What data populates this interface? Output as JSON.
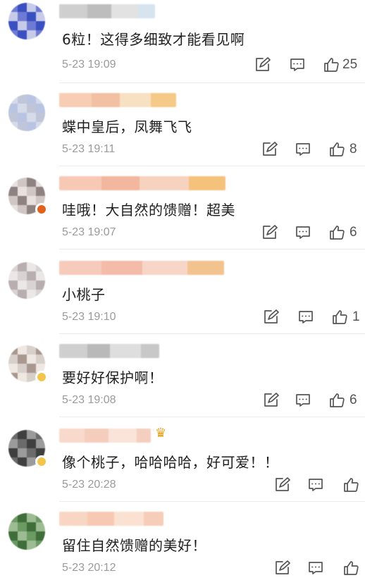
{
  "comments": [
    {
      "text": "6粒！这得多细致才能看见啊",
      "time": "5-23 19:09",
      "likes": "25",
      "avatar_colors": [
        "#6f7bd3",
        "#3a4fc0",
        "#c7cbe8"
      ],
      "name_colors": [
        "#cfcfcf",
        "#bdbdbd",
        "#e2e2e2",
        "#d6e4f0"
      ]
    },
    {
      "text": "蝶中皇后，凤舞飞飞",
      "time": "5-23 19:11",
      "likes": "8",
      "avatar_colors": [
        "#b9c3e2",
        "#d6dbe9",
        "#c0c6d8"
      ],
      "name_colors": [
        "#f7cdb4",
        "#f2c0a2",
        "#f8e0c3",
        "#f5c987"
      ]
    },
    {
      "text": "哇哦！大自然的馈赠！超美",
      "time": "5-23 19:07",
      "likes": "6",
      "avatar_colors": [
        "#d0c7c4",
        "#8e8381",
        "#e9e1dd"
      ],
      "name_colors": [
        "#f7c9b5",
        "#f2b79e",
        "#f7d2bf",
        "#f5c27c"
      ]
    },
    {
      "text": "小桃子",
      "time": "5-23 19:10",
      "likes": "1",
      "avatar_colors": [
        "#d9d3d3",
        "#b8aeb0",
        "#ebe7e7"
      ],
      "name_colors": [
        "#f6cbbb",
        "#f3bba8",
        "#f7d6c8",
        "#f2c38f"
      ]
    },
    {
      "text": "要好好保护啊！",
      "time": "5-23 19:08",
      "likes": "6",
      "avatar_colors": [
        "#d7cfc9",
        "#a99890",
        "#efe7e1"
      ],
      "name_colors": [
        "#cfcfcf",
        "#b9b9b9",
        "#dedede",
        "#c8c8c8"
      ]
    },
    {
      "text": "像个桃子，哈哈哈哈，好可爱！！",
      "time": "5-23 20:28",
      "likes": "",
      "avatar_colors": [
        "#3f3f3f",
        "#9b9b9b",
        "#6b6b6b"
      ],
      "name_colors": [
        "#f9d9cc",
        "#f5cdbd",
        "#fae3d9",
        "#f4cfbf"
      ]
    },
    {
      "text": "留住自然馈赠的美好！",
      "time": "5-23 20:12",
      "likes": "",
      "avatar_colors": [
        "#6b9a63",
        "#3f6e3a",
        "#9dbc93"
      ],
      "name_colors": [
        "#f9d6c4",
        "#f7c9b2",
        "#fbe1d2",
        "#f5cdb8"
      ]
    }
  ],
  "icons": {
    "share": "share-edit-icon",
    "reply": "comment-bubble-icon",
    "like": "thumbs-up-icon"
  },
  "colors": {
    "text": "#1f1f1f",
    "meta": "#9a9a9a",
    "icon": "#555555"
  }
}
